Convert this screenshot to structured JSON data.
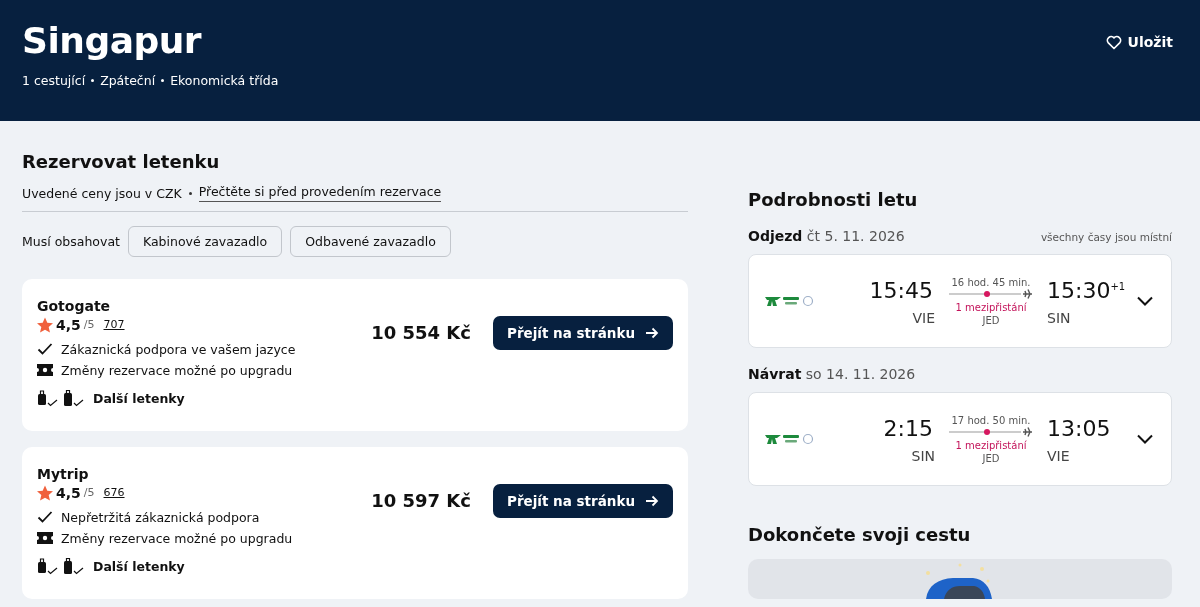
{
  "header": {
    "title": "Singapur",
    "details": [
      "1 cestující",
      "Zpáteční",
      "Ekonomická třída"
    ],
    "save_button": "Uložit"
  },
  "booking": {
    "title": "Rezervovat letenku",
    "currency_note": "Uvedené ceny jsou v CZK",
    "info_link": "Přečtěte si před provedením rezervace",
    "filter_label": "Musí obsahovat",
    "filters": [
      {
        "label": "Kabinové zavazadlo",
        "selected": false
      },
      {
        "label": "Odbavené zavazadlo",
        "selected": false
      }
    ]
  },
  "offers": [
    {
      "provider": "Gotogate",
      "rating": "4,5",
      "rating_scale": "/5",
      "reviews": "707",
      "features": [
        {
          "kind": "check",
          "text": "Zákaznická podpora ve vašem jazyce"
        },
        {
          "kind": "ticket",
          "text": "Změny rezervace možné po upgradu"
        }
      ],
      "more": "Další letenky",
      "price": "10 554 Kč",
      "button": "Přejít na stránku"
    },
    {
      "provider": "Mytrip",
      "rating": "4,5",
      "rating_scale": "/5",
      "reviews": "676",
      "features": [
        {
          "kind": "check",
          "text": "Nepřetržitá zákaznická podpora"
        },
        {
          "kind": "ticket",
          "text": "Změny rezervace možné po upgradu"
        }
      ],
      "more": "Další letenky",
      "price": "10 597 Kč",
      "button": "Přejít na stránku"
    }
  ],
  "flight_details": {
    "title": "Podrobnosti letu",
    "note": "všechny časy jsou místní",
    "legs": [
      {
        "label": "Odjezd",
        "date": "čt 5. 11. 2026",
        "depart_time": "15:45",
        "depart_airport": "VIE",
        "duration": "16 hod. 45 min.",
        "stops": "1 mezipřistání",
        "stop_airport": "JED",
        "arrive_time": "15:30$^{+1}$",
        "arrive_airport": "SIN"
      },
      {
        "label": "Návrat",
        "date": "so 14. 11. 2026",
        "depart_time": "2:15",
        "depart_airport": "SIN",
        "duration": "17 hod. 50 min.",
        "stops": "1 mezipřistání",
        "stop_airport": "JED",
        "arrive_time": "13:05",
        "arrive_airport": "VIE"
      }
    ]
  },
  "extras": {
    "title": "Dokončete svoji cestu",
    "kind": "picture"
  }
}
